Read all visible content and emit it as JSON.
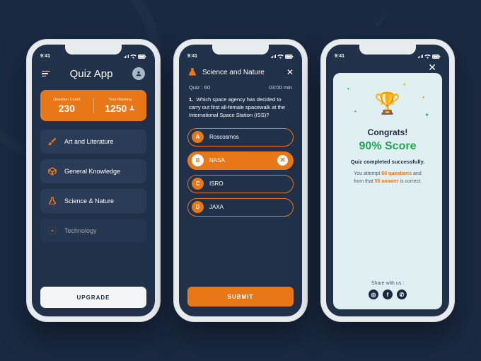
{
  "status": {
    "time": "9:41"
  },
  "screen1": {
    "title": "Quiz App",
    "stats": {
      "q_label": "Question Count",
      "q_value": "230",
      "r_label": "Your Ranking",
      "r_value": "1250"
    },
    "categories": [
      {
        "label": "Art and Literature"
      },
      {
        "label": "General Knowledge"
      },
      {
        "label": "Science & Nature"
      },
      {
        "label": "Technology"
      }
    ],
    "upgrade": "UPGRADE"
  },
  "screen2": {
    "title": "Science and Nature",
    "quiz_count": "Quiz : 60",
    "timer": "03:00 min",
    "q_num": "1.",
    "q_text": "Which space agency has decided to carry out first all-female spacewalk at the International Space Station (ISS)?",
    "options": [
      {
        "letter": "A",
        "label": "Roscosmos"
      },
      {
        "letter": "B",
        "label": "NASA"
      },
      {
        "letter": "C",
        "label": "ISRO"
      },
      {
        "letter": "D",
        "label": "JAXA"
      }
    ],
    "submit": "SUBMIT"
  },
  "screen3": {
    "congrats": "Congrats!",
    "score": "90% Score",
    "done": "Quiz completed successfully.",
    "line1a": "You attempt ",
    "line1b": "60 questions",
    "line1c": " and",
    "line2a": "from that ",
    "line2b": "55 answer",
    "line2c": " is correct.",
    "share_label": "Share with us :"
  }
}
